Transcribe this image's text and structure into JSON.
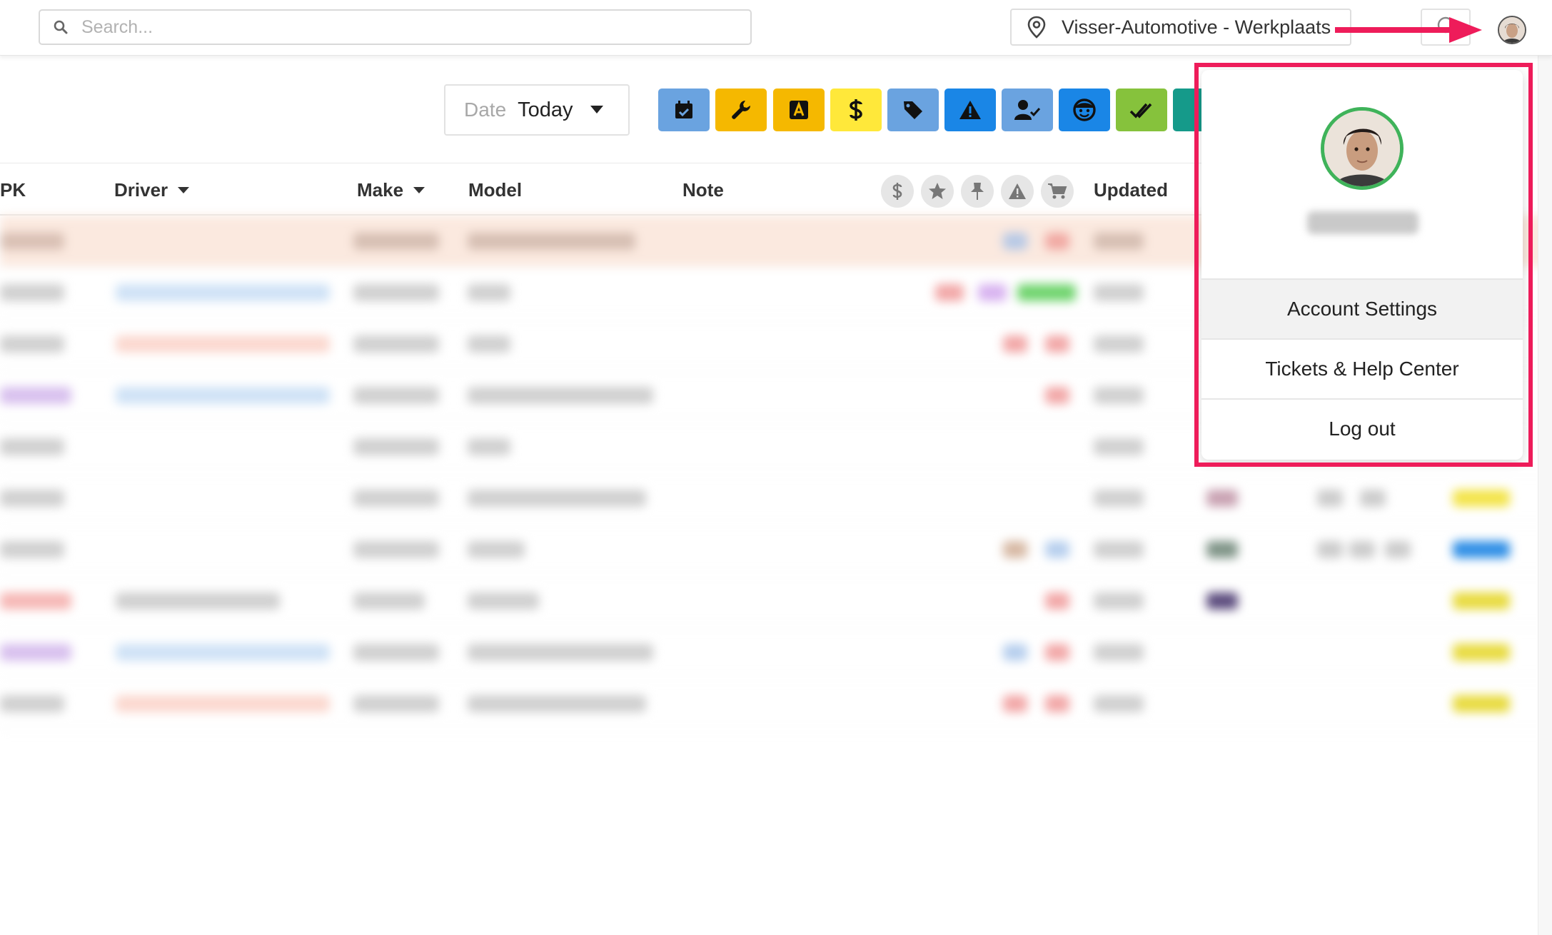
{
  "header": {
    "search_placeholder": "Search...",
    "location": "Visser-Automotive - Werkplaats"
  },
  "filter": {
    "date_label": "Date",
    "date_value": "Today"
  },
  "toolbar_buttons": [
    {
      "name": "calendar-check-icon",
      "color": "#6aa3e0"
    },
    {
      "name": "wrench-icon",
      "color": "#f5b800"
    },
    {
      "name": "letter-a-icon",
      "color": "#f5b800"
    },
    {
      "name": "dollar-icon",
      "color": "#ffe83a"
    },
    {
      "name": "tag-icon",
      "color": "#6aa3e0"
    },
    {
      "name": "warning-icon",
      "color": "#1a86e6"
    },
    {
      "name": "user-check-icon",
      "color": "#6aa3e0"
    },
    {
      "name": "face-icon",
      "color": "#1a86e6"
    },
    {
      "name": "double-check-icon",
      "color": "#86c23c"
    },
    {
      "name": "shield-icon",
      "color": "#159a8a"
    }
  ],
  "table": {
    "columns": [
      "PK",
      "Driver",
      "Make",
      "Model",
      "Note",
      "Updated"
    ],
    "header_icons": [
      "dollar-icon",
      "star-icon",
      "pin-icon",
      "warning-icon",
      "cart-icon"
    ]
  },
  "account_menu": {
    "items": [
      "Account Settings",
      "Tickets & Help Center",
      "Log out"
    ]
  },
  "colors": {
    "annotation": "#ee1c5a",
    "avatar_ring": "#3fb35a"
  }
}
